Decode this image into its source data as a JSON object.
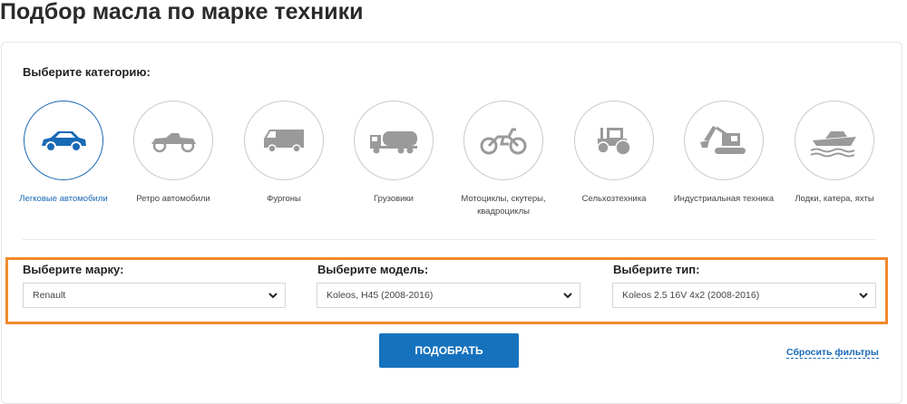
{
  "page_title": "Подбор масла по марке техники",
  "category_label": "Выберите категорию:",
  "categories": [
    {
      "name": "Легковые автомобили",
      "icon": "car-icon",
      "active": true
    },
    {
      "name": "Ретро автомобили",
      "icon": "retro-car-icon",
      "active": false
    },
    {
      "name": "Фургоны",
      "icon": "van-icon",
      "active": false
    },
    {
      "name": "Грузовики",
      "icon": "truck-icon",
      "active": false
    },
    {
      "name": "Мотоциклы, скутеры, квадроциклы",
      "icon": "motorcycle-icon",
      "active": false
    },
    {
      "name": "Сельхозтехника",
      "icon": "tractor-icon",
      "active": false
    },
    {
      "name": "Индустриальная техника",
      "icon": "excavator-icon",
      "active": false
    },
    {
      "name": "Лодки, катера, яхты",
      "icon": "boat-icon",
      "active": false
    }
  ],
  "filters": {
    "brand_label": "Выберите марку:",
    "brand_value": "Renault",
    "model_label": "Выберите модель:",
    "model_value": "Koleos, H45 (2008-2016)",
    "type_label": "Выберите тип:",
    "type_value": "Koleos 2.5 16V 4x2 (2008-2016)"
  },
  "submit_label": "ПОДОБРАТЬ",
  "reset_label": "Сбросить фильтры",
  "colors": {
    "accent": "#1869b6",
    "button": "#1672bd",
    "highlight": "#f08a2c",
    "icon_gray": "#9a9a9a"
  }
}
